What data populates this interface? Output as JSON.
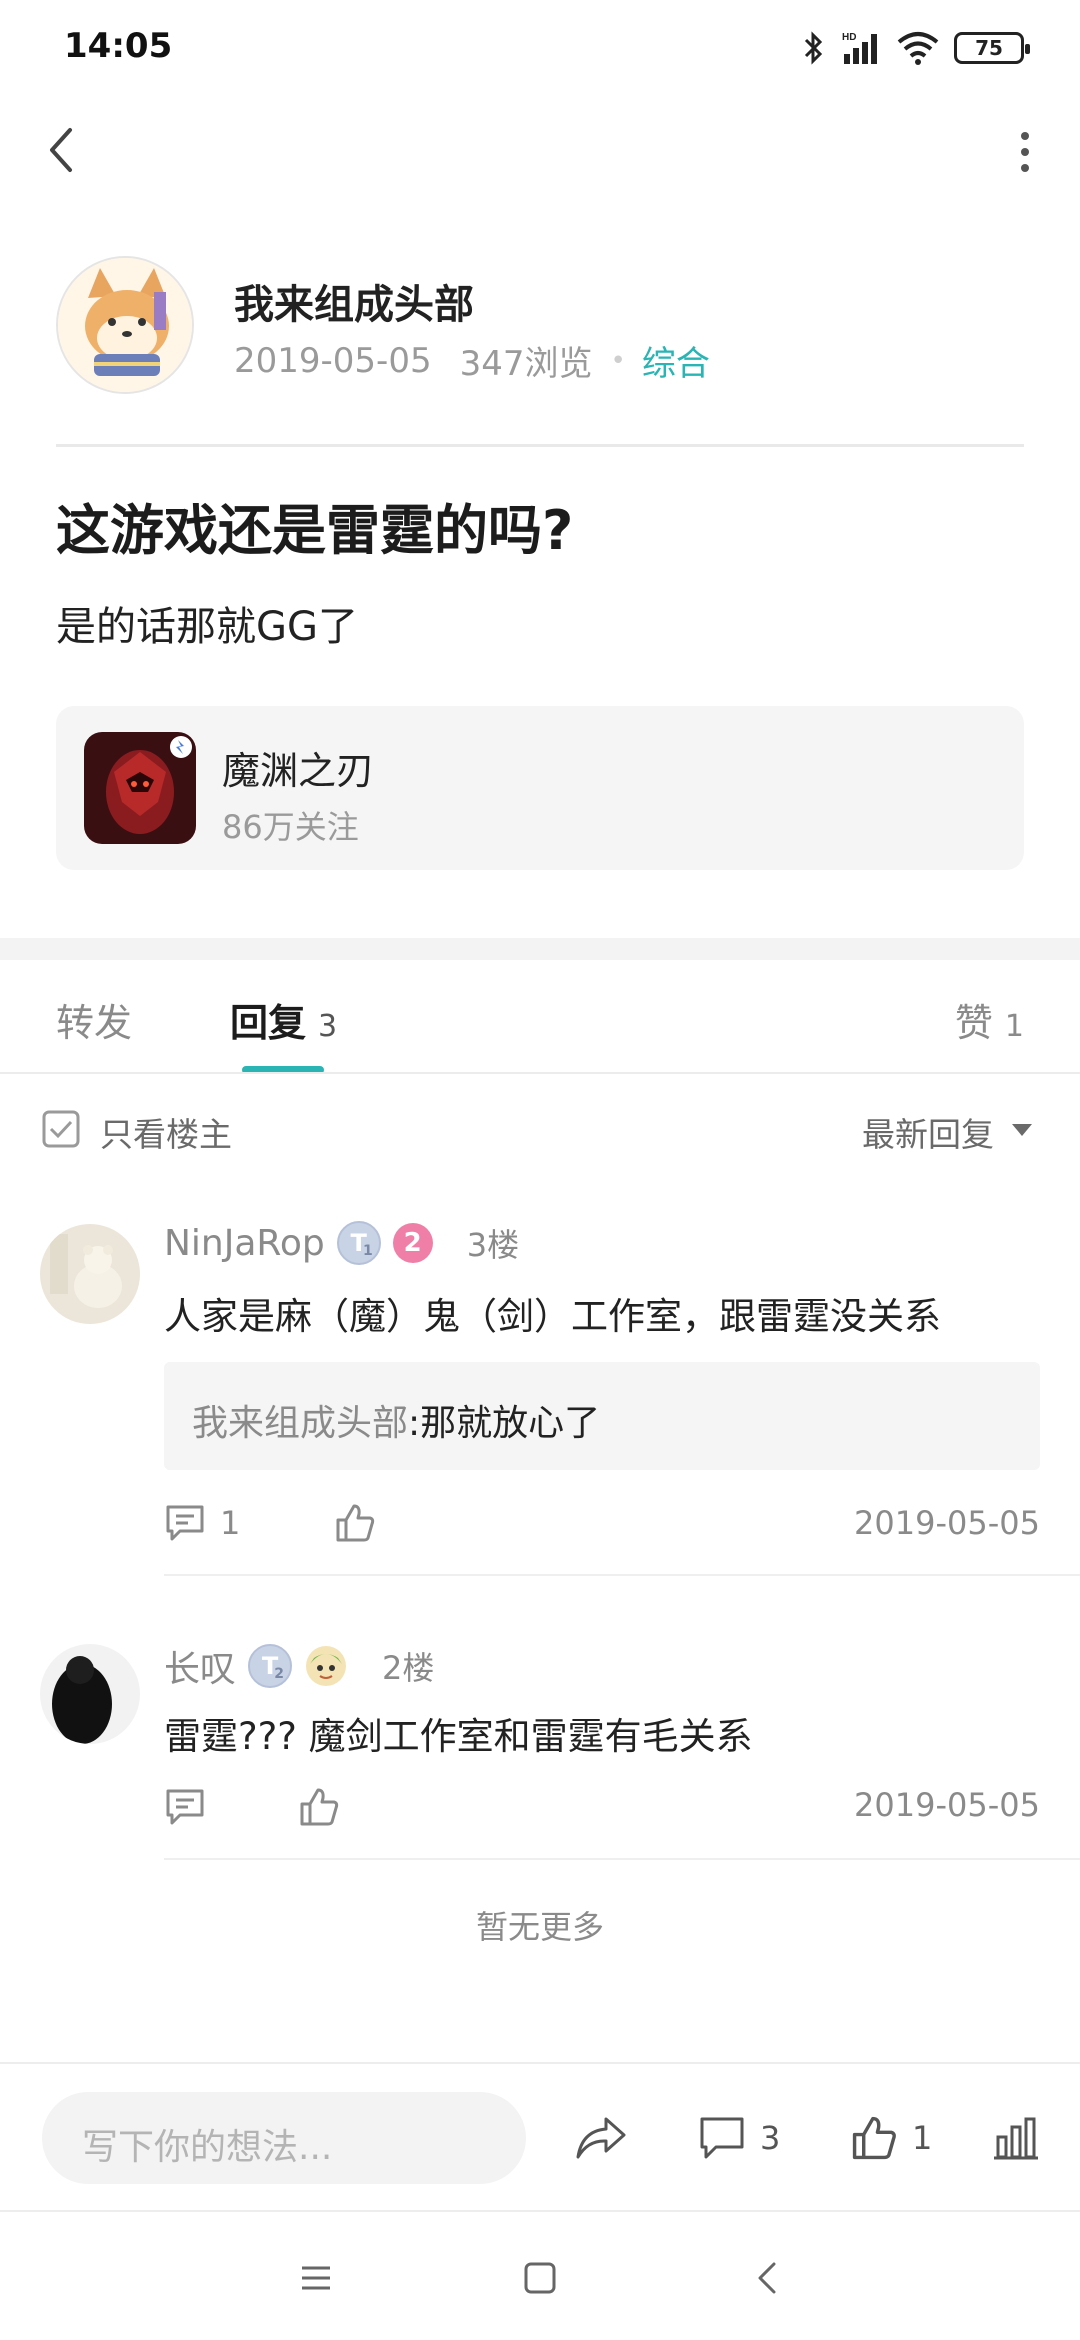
{
  "status_bar": {
    "time": "14:05",
    "battery": "75",
    "network": "HD"
  },
  "author": {
    "name": "我来组成头部",
    "date": "2019-05-05",
    "views": "347浏览",
    "category": "综合"
  },
  "post": {
    "title": "这游戏还是雷霆的吗?",
    "body": "是的话那就GG了"
  },
  "game": {
    "name": "魔渊之刃",
    "followers": "86万关注"
  },
  "tabs": {
    "repost": "转发",
    "reply": "回复",
    "reply_count": "3",
    "like": "赞",
    "like_count": "1"
  },
  "filter": {
    "only_owner": "只看楼主",
    "sort": "最新回复"
  },
  "comments": [
    {
      "user": "NinJaRop",
      "level": "2",
      "title_badge": "T",
      "title_badge_sub": "1",
      "floor": "3楼",
      "text": "人家是麻（魔）鬼（剑）工作室，跟雷霆没关系",
      "quote_name": "我来组成头部",
      "quote_text": ":那就放心了",
      "reply_count": "1",
      "date": "2019-05-05"
    },
    {
      "user": "长叹",
      "title_badge": "T",
      "title_badge_sub": "2",
      "floor": "2楼",
      "text": "雷霆??? 魔剑工作室和雷霆有毛关系",
      "date": "2019-05-05"
    }
  ],
  "no_more": "暂无更多",
  "bottom_bar": {
    "placeholder": "写下你的想法...",
    "comment_count": "3",
    "like_count": "1"
  },
  "colors": {
    "accent": "#2ab4b4",
    "level_badge": "#f07fa8"
  }
}
